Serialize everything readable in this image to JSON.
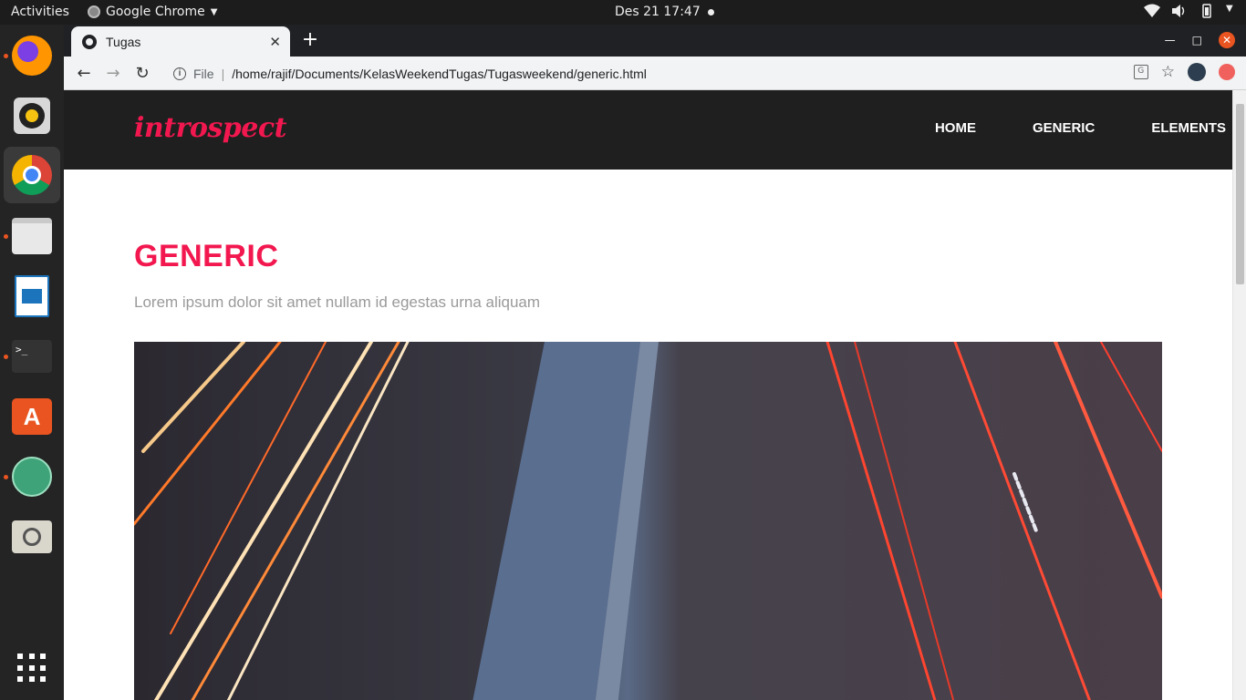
{
  "topbar": {
    "activities": "Activities",
    "app_name": "Google Chrome",
    "clock": "Des 21  17:47"
  },
  "dock": {
    "items": [
      "firefox-icon",
      "rhythmbox-icon",
      "chrome-icon",
      "files-icon",
      "libreoffice-impress-icon",
      "terminal-icon",
      "software-center-icon",
      "atom-icon",
      "image-viewer-icon"
    ]
  },
  "browser": {
    "tab_title": "Tugas",
    "url_scheme": "File",
    "url_path": "/home/rajif/Documents/KelasWeekendTugas/Tugasweekend/generic.html"
  },
  "site": {
    "logo": "introspect",
    "nav": [
      "HOME",
      "GENERIC",
      "ELEMENTS"
    ],
    "page_title": "GENERIC",
    "lead": "Lorem ipsum dolor sit amet nullam id egestas urna aliquam"
  },
  "colors": {
    "accent": "#f2184f",
    "header_bg": "#1f1f1f",
    "ubuntu_orange": "#e95420"
  }
}
